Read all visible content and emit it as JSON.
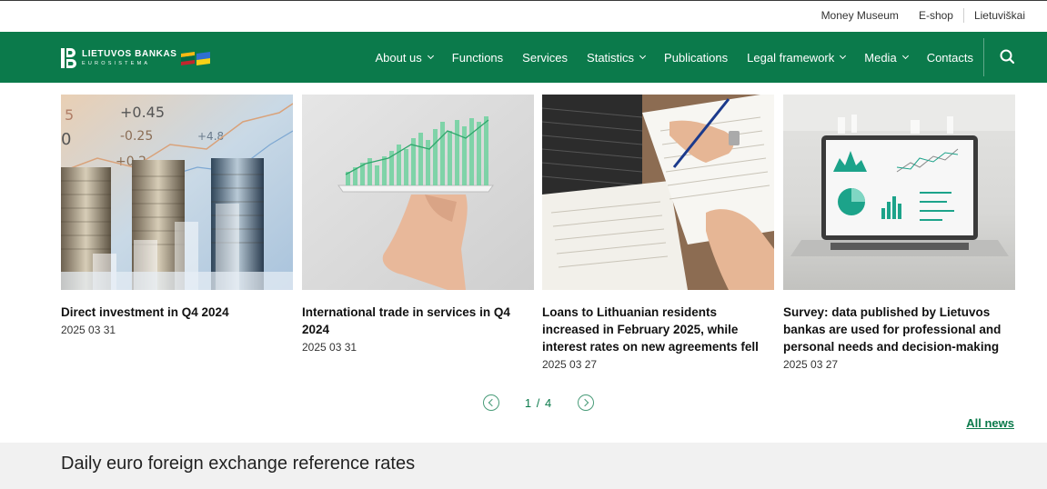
{
  "topbar": {
    "links": [
      "Money Museum",
      "E-shop",
      "Lietuviškai"
    ]
  },
  "logo": {
    "title": "LIETUVOS BANKAS",
    "subtitle": "EUROSISTEMA"
  },
  "nav": {
    "items": [
      {
        "label": "About us",
        "dropdown": true
      },
      {
        "label": "Functions",
        "dropdown": false
      },
      {
        "label": "Services",
        "dropdown": false
      },
      {
        "label": "Statistics",
        "dropdown": true
      },
      {
        "label": "Publications",
        "dropdown": false
      },
      {
        "label": "Legal framework",
        "dropdown": true
      },
      {
        "label": "Media",
        "dropdown": true
      },
      {
        "label": "Contacts",
        "dropdown": false
      }
    ],
    "search_icon": "search-icon"
  },
  "news": [
    {
      "title": "Direct investment in Q4 2024",
      "date": "2025 03 31"
    },
    {
      "title": "International trade in services in Q4 2024",
      "date": "2025 03 31"
    },
    {
      "title": "Loans to Lithuanian residents increased in February 2025, while interest rates on new agreements fell",
      "date": "2025 03 27"
    },
    {
      "title": "Survey: data published by Lietuvos bankas are used for professional and personal needs and decision-making",
      "date": "2025 03 27"
    }
  ],
  "pager": {
    "current": "1",
    "separator": "/",
    "total": "4"
  },
  "all_news_label": "All news",
  "rates": {
    "title": "Daily euro foreign exchange reference rates"
  },
  "colors": {
    "brand_green": "#0b7a4b",
    "rates_bg": "#f1f1f1"
  }
}
